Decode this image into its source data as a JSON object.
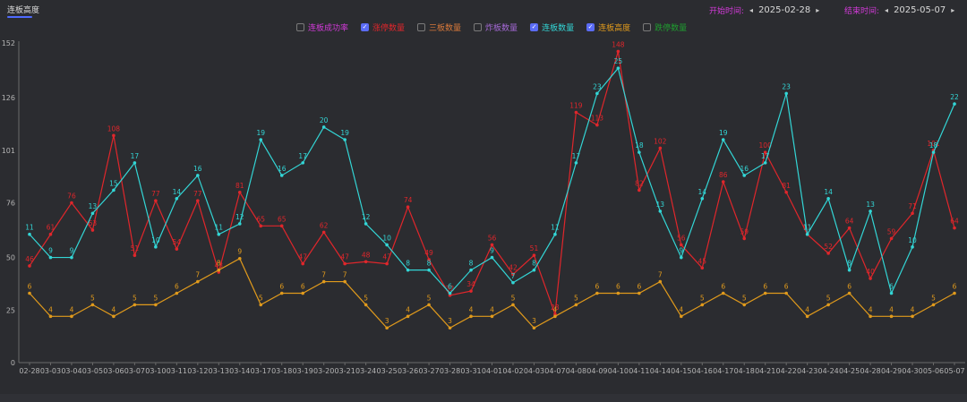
{
  "tab": {
    "label": "连板高度"
  },
  "date_range": {
    "start_label": "开始时间:",
    "start_value": "2025-02-28",
    "end_label": "结束时间:",
    "end_value": "2025-05-07",
    "prev_symbol": "◂",
    "next_symbol": "▸"
  },
  "legend": [
    {
      "label": "连板成功率",
      "checked": false,
      "color": "#d23ad8"
    },
    {
      "label": "涨停数量",
      "checked": true,
      "color": "#e0262b"
    },
    {
      "label": "三板数量",
      "checked": false,
      "color": "#d9793a"
    },
    {
      "label": "炸板数量",
      "checked": false,
      "color": "#a569d6"
    },
    {
      "label": "连板数量",
      "checked": true,
      "color": "#33d6d6"
    },
    {
      "label": "连板高度",
      "checked": true,
      "color": "#e09a1c"
    },
    {
      "label": "跌停数量",
      "checked": false,
      "color": "#1f9d2f"
    }
  ],
  "chart_data": {
    "type": "line",
    "categories": [
      "02-28",
      "03-03",
      "03-04",
      "03-05",
      "03-06",
      "03-07",
      "03-10",
      "03-11",
      "03-12",
      "03-13",
      "03-14",
      "03-17",
      "03-18",
      "03-19",
      "03-20",
      "03-21",
      "03-24",
      "03-25",
      "03-26",
      "03-27",
      "03-28",
      "03-31",
      "04-01",
      "04-02",
      "04-03",
      "04-07",
      "04-08",
      "04-09",
      "04-10",
      "04-11",
      "04-14",
      "04-15",
      "04-16",
      "04-17",
      "04-18",
      "04-21",
      "04-22",
      "04-23",
      "04-24",
      "04-25",
      "04-28",
      "04-29",
      "04-30",
      "05-06",
      "05-07"
    ],
    "y_ticks": [
      0,
      25,
      50,
      76,
      101,
      126,
      152
    ],
    "ylim": [
      0,
      152
    ],
    "grid": false,
    "series": [
      {
        "name": "涨停数量",
        "color": "#e0262b",
        "values": [
          46,
          61,
          76,
          63,
          108,
          51,
          77,
          54,
          77,
          43,
          81,
          65,
          65,
          47,
          62,
          47,
          48,
          47,
          74,
          49,
          32,
          34,
          56,
          42,
          51,
          23,
          119,
          113,
          148,
          82,
          102,
          56,
          45,
          86,
          59,
          100,
          81,
          61,
          52,
          64,
          40,
          59,
          71,
          101,
          64
        ],
        "labels": [
          "46",
          "61",
          "76",
          "63",
          "108",
          "51",
          "77",
          "54",
          "77",
          "43",
          "81",
          "65",
          "65",
          "47",
          "62",
          "47",
          "48",
          "47",
          "74",
          "49",
          "32",
          "34",
          "56",
          "42",
          "51",
          "23",
          "119",
          "113",
          "148",
          "82",
          "102",
          "56",
          "45",
          "86",
          "59",
          "100",
          "81",
          "61",
          "52",
          "64",
          "40",
          "59",
          "71",
          "101",
          "64"
        ]
      },
      {
        "name": "连板数量",
        "color": "#33d6d6",
        "values": [
          61,
          50,
          50,
          71,
          82,
          95,
          55,
          78,
          89,
          61,
          66,
          106,
          89,
          95,
          112,
          106,
          66,
          56,
          44,
          44,
          33,
          44,
          50,
          38,
          44,
          61,
          95,
          128,
          140,
          100,
          72,
          50,
          78,
          106,
          89,
          95,
          128,
          61,
          78,
          44,
          72,
          33,
          55,
          100,
          123
        ],
        "labels": [
          "11",
          "9",
          "9",
          "13",
          "15",
          "17",
          "10",
          "14",
          "16",
          "11",
          "12",
          "19",
          "16",
          "17",
          "20",
          "19",
          "12",
          "10",
          "8",
          "8",
          "6",
          "8",
          "9",
          "7",
          "8",
          "11",
          "17",
          "23",
          "25",
          "18",
          "13",
          "9",
          "14",
          "19",
          "16",
          "17",
          "23",
          "11",
          "14",
          "8",
          "13",
          "6",
          "10",
          "18",
          "22"
        ]
      },
      {
        "name": "连板高度",
        "color": "#e09a1c",
        "values": [
          6,
          4,
          4,
          5,
          4,
          5,
          5,
          6,
          7,
          8,
          9,
          5,
          6,
          6,
          7,
          7,
          5,
          3,
          4,
          5,
          3,
          4,
          4,
          5,
          3,
          4,
          5,
          6,
          6,
          6,
          7,
          4,
          5,
          6,
          5,
          6,
          6,
          4,
          5,
          6,
          4,
          4,
          4,
          5,
          6
        ],
        "labels": [
          "6",
          "4",
          "4",
          "5",
          "4",
          "5",
          "5",
          "6",
          "7",
          "8",
          "9",
          "5",
          "6",
          "6",
          "7",
          "7",
          "5",
          "3",
          "4",
          "5",
          "3",
          "4",
          "4",
          "5",
          "3",
          "4",
          "5",
          "6",
          "6",
          "6",
          "7",
          "4",
          "5",
          "6",
          "5",
          "6",
          "6",
          "4",
          "5",
          "6",
          "4",
          "4",
          "4",
          "5",
          "6"
        ],
        "scale": 5.5
      }
    ]
  }
}
